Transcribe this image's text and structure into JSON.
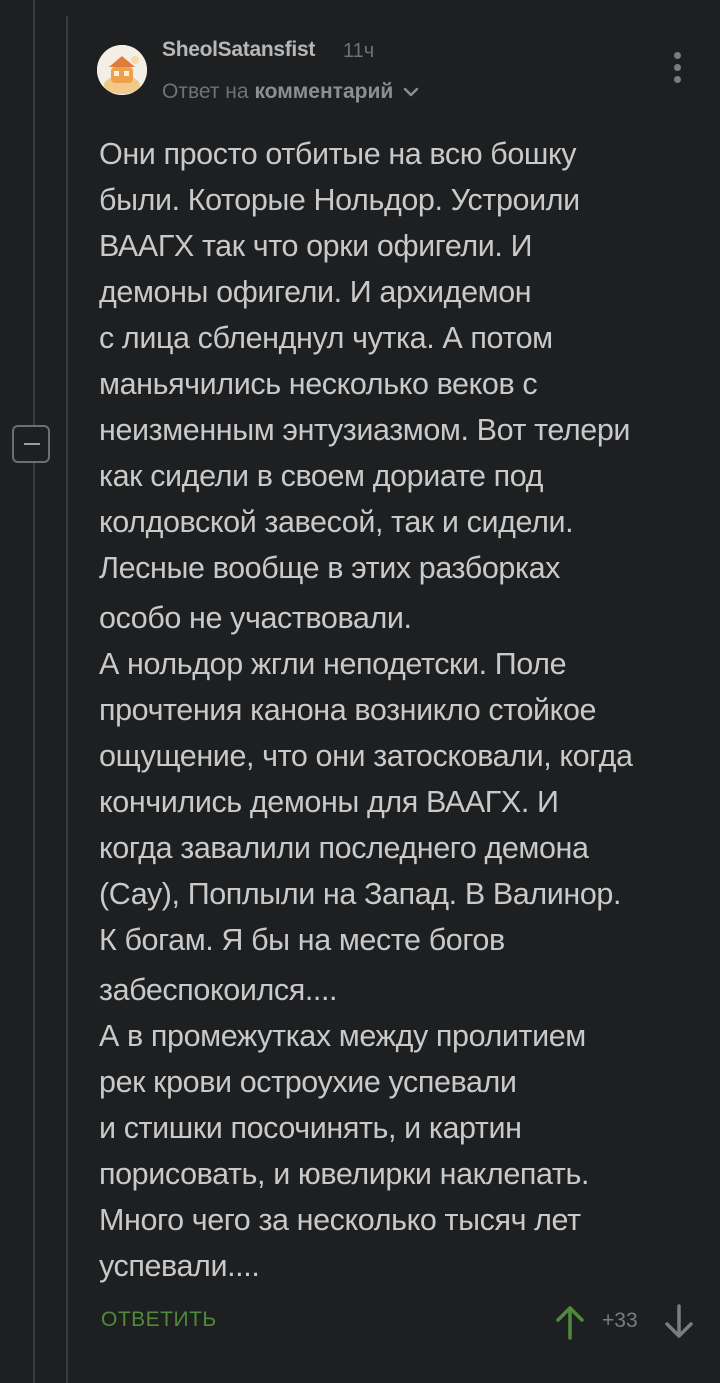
{
  "comment": {
    "author": "SheolSatansfist",
    "time": "11ч",
    "reply_prefix": "Ответ на",
    "reply_link": "комментарий",
    "lines": [
      "Они просто отбитые на всю бошку",
      "были. Которые Нольдор. Устроили",
      "ВААГХ так что орки офигели. И",
      "демоны офигели. И архидемон",
      "с лица сбленднул чутка. А потом",
      "маньячились несколько веков с",
      "неизменным энтузиазмом. Вот телери",
      "как сидели в своем дориате под",
      "колдовской завесой, так и сидели.",
      "Лесные вообще в этих разборках",
      "особо не участвовали.",
      "А нольдор жгли неподетски. Поле",
      "прочтения канона возникло стойкое",
      "ощущение, что они затосковали, когда",
      "кончились демоны для ВААГХ. И",
      "когда завалили последнего демона",
      "(Сау), Поплыли на Запад. В Валинор.",
      "К богам. Я бы на месте богов",
      "забеспокоился....",
      "А в промежутках между пролитием",
      "рек крови остроухие успевали",
      "и стишки посочинять, и картин",
      "порисовать, и ювелирки наклепать.",
      "Много чего за несколько тысяч лет",
      "успевали...."
    ],
    "reply_label": "ОТВЕТИТЬ",
    "score": "+33"
  },
  "icons": {
    "avatar": "avatar-icon",
    "more": "more-vertical-icon",
    "collapse": "collapse-minus-icon",
    "upvote": "arrow-up-icon",
    "downvote": "arrow-down-icon",
    "chevron": "chevron-down-icon"
  },
  "colors": {
    "background": "#1d1f21",
    "text": "#c9c9c9",
    "muted": "#6f7174",
    "reply_green": "#4f8a3c",
    "upvote_green": "#4f8a3c"
  }
}
